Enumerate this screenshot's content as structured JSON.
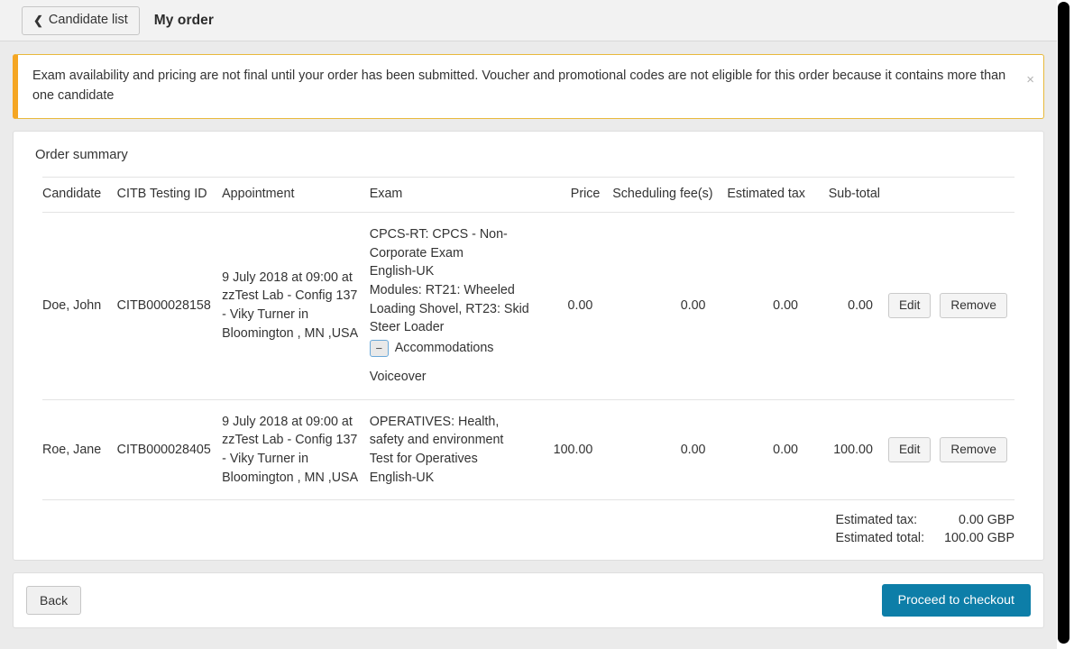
{
  "topbar": {
    "back_button_label": "Candidate list",
    "back_chevron": "❮",
    "page_title": "My order"
  },
  "alert": {
    "message": "Exam availability and pricing are not final until your order has been submitted. Voucher and promotional codes are not eligible for this order because it contains more than one candidate",
    "close_label": "×",
    "accent_color": "#f5a623",
    "border_color": "#e8b93c"
  },
  "card": {
    "heading": "Order summary",
    "columns": [
      "Candidate",
      "CITB Testing ID",
      "Appointment",
      "Exam",
      "Price",
      "Scheduling fee(s)",
      "Estimated tax",
      "Sub-total"
    ],
    "rows": [
      {
        "candidate": "Doe, John",
        "testing_id": "CITB000028158",
        "appointment": "9 July 2018 at 09:00 at zzTest Lab - Config 137 - Viky Turner in Bloomington , MN ,USA",
        "exam_name": "CPCS-RT: CPCS - Non-Corporate Exam",
        "exam_language": "English-UK",
        "exam_modules": "Modules: RT21: Wheeled Loading Shovel, RT23: Skid Steer Loader",
        "accommodations_label": "Accommodations",
        "accommodations_toggle": "−",
        "accommodations_value": "Voiceover",
        "price": "0.00",
        "scheduling_fee": "0.00",
        "estimated_tax": "0.00",
        "sub_total": "0.00",
        "edit_label": "Edit",
        "remove_label": "Remove"
      },
      {
        "candidate": "Roe, Jane",
        "testing_id": "CITB000028405",
        "appointment": "9 July 2018 at 09:00 at zzTest Lab - Config 137 - Viky Turner in Bloomington , MN ,USA",
        "exam_name": "OPERATIVES: Health, safety and environment Test for Operatives",
        "exam_language": "English-UK",
        "exam_modules": "",
        "accommodations_label": "",
        "accommodations_toggle": "",
        "accommodations_value": "",
        "price": "100.00",
        "scheduling_fee": "0.00",
        "estimated_tax": "0.00",
        "sub_total": "100.00",
        "edit_label": "Edit",
        "remove_label": "Remove"
      }
    ],
    "totals": {
      "tax_label": "Estimated tax:",
      "tax_value": "0.00 GBP",
      "total_label": "Estimated total:",
      "total_value": "100.00 GBP"
    }
  },
  "footer": {
    "back_label": "Back",
    "checkout_label": "Proceed to checkout",
    "checkout_color": "#0d7ea8"
  }
}
